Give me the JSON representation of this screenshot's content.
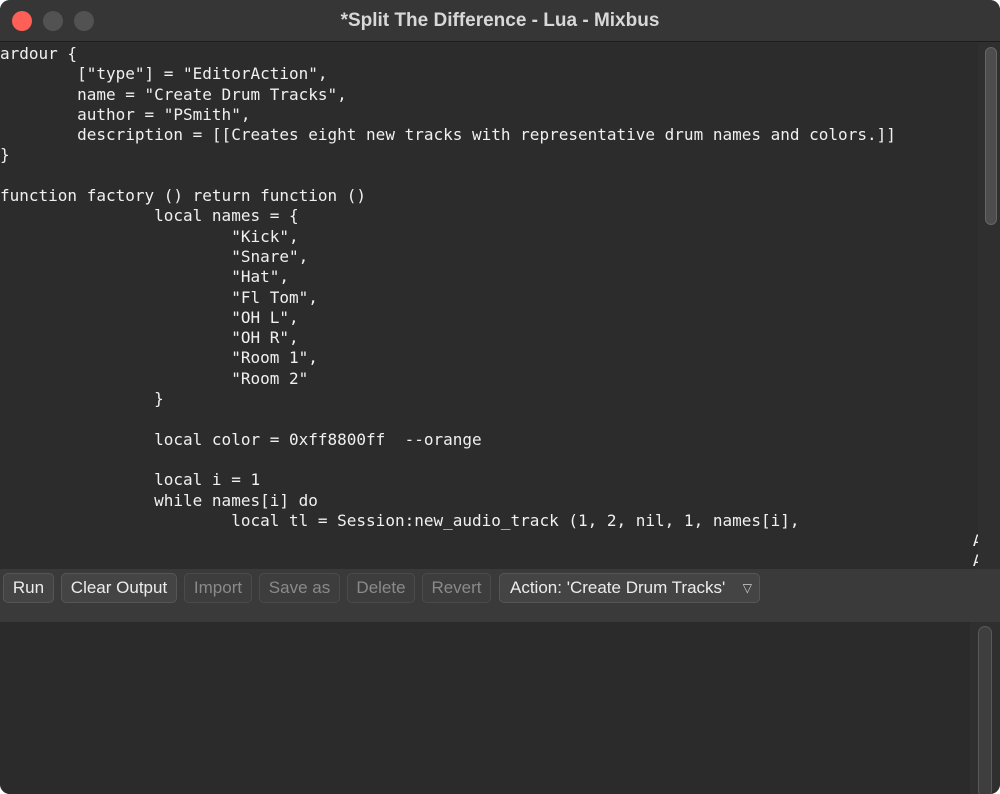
{
  "window": {
    "title": "*Split The Difference - Lua - Mixbus"
  },
  "editor": {
    "lines": [
      "ardour {",
      "\t[\"type\"] = \"EditorAction\",",
      "\tname = \"Create Drum Tracks\",",
      "\tauthor = \"PSmith\",",
      "\tdescription = [[Creates eight new tracks with representative drum names and colors.]]",
      "}",
      "",
      "function factory () return function ()",
      "\t\tlocal names = {",
      "\t\t\t\"Kick\",",
      "\t\t\t\"Snare\",",
      "\t\t\t\"Hat\",",
      "\t\t\t\"Fl Tom\",",
      "\t\t\t\"OH L\",",
      "\t\t\t\"OH R\",",
      "\t\t\t\"Room 1\",",
      "\t\t\t\"Room 2\"",
      "\t\t}",
      "",
      "\t\tlocal color = 0xff8800ff  --orange",
      "",
      "\t\tlocal i = 1",
      "\t\twhile names[i] do",
      "\t\t\tlocal tl = Session:new_audio_track (1, 2, nil, 1, names[i],",
      "\t\t\t\t\t\t\t\t\t\t\t\t     ARDOUR.PresentationInfo.max_order,",
      "\t\t\t\t\t\t\t\t\t\t\t\t     ARDOUR.TrackMode.Normal, true)"
    ]
  },
  "toolbar": {
    "run_label": "Run",
    "clear_output_label": "Clear Output",
    "import_label": "Import",
    "save_as_label": "Save as",
    "delete_label": "Delete",
    "revert_label": "Revert",
    "action_label": "Action: 'Create Drum Tracks'",
    "dropdown_arrow": "▽"
  },
  "colors": {
    "close_button": "#fe5f57",
    "background": "#2f2f2f",
    "text": "#f0f0f0"
  },
  "icons": {
    "dropdown": "triangle-down-icon"
  }
}
